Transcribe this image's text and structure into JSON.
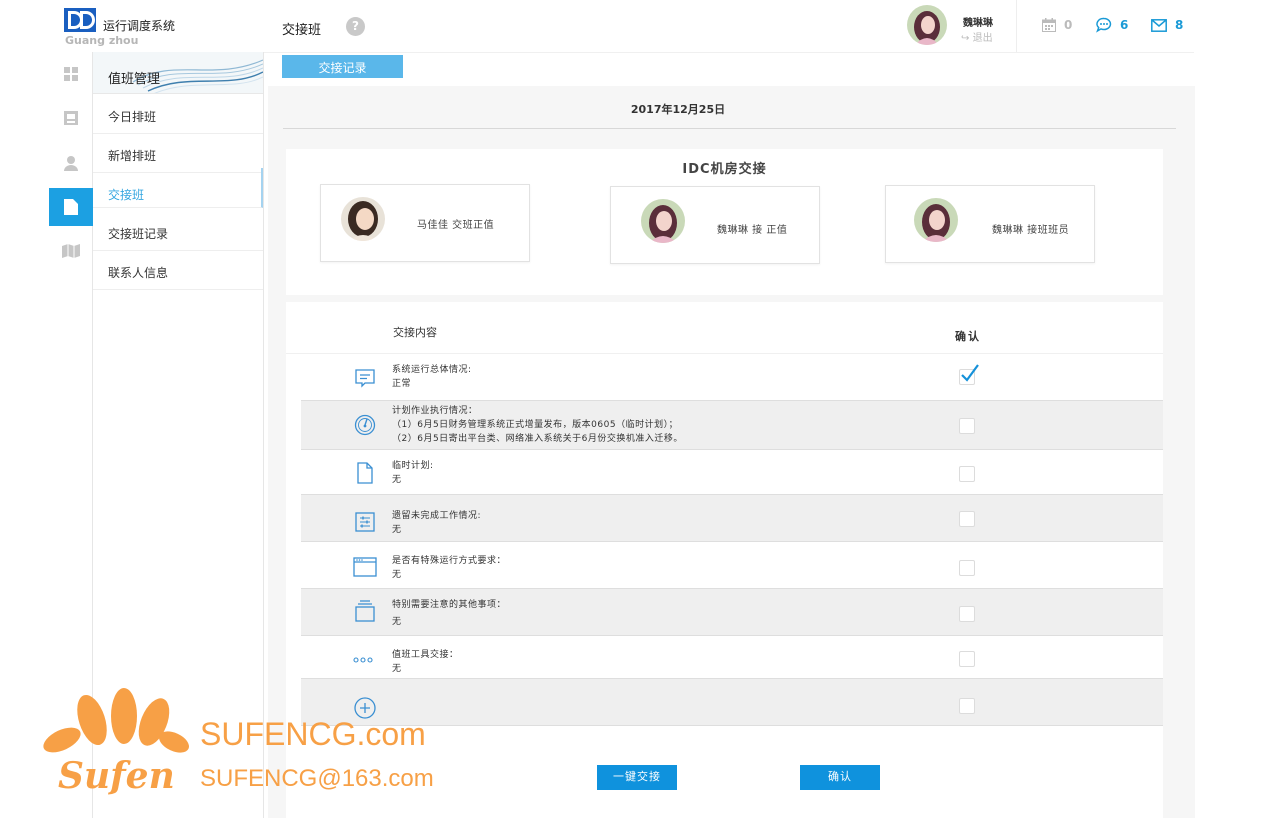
{
  "app": {
    "logo_title": "运行调度系统",
    "logo_sub": "Guang zhou",
    "logo_letter": "D"
  },
  "sidebar": {
    "header": "值班管理",
    "items": [
      {
        "label": "今日排班",
        "active": false
      },
      {
        "label": "新增排班",
        "active": false
      },
      {
        "label": "交接班",
        "active": true
      },
      {
        "label": "交接班记录",
        "active": false
      },
      {
        "label": "联系人信息",
        "active": false
      }
    ]
  },
  "rail": {
    "icons": [
      "grid-icon",
      "id-card-icon",
      "user-icon",
      "document-icon",
      "map-icon"
    ],
    "active_index": 3
  },
  "header": {
    "title": "交接班",
    "help": "?",
    "user_name": "魏琳琳",
    "logout": "退出",
    "stats": [
      {
        "icon": "calendar-icon",
        "count": "0",
        "color": "#bbbbbb"
      },
      {
        "icon": "chat-icon",
        "count": "6",
        "color": "#1a9ad6"
      },
      {
        "icon": "mail-icon",
        "count": "8",
        "color": "#1a9ad6"
      }
    ]
  },
  "tab": {
    "label": "交接记录"
  },
  "main": {
    "date": "2017年12月25日",
    "card_title": "IDC机房交接",
    "people": [
      {
        "label": "马佳佳   交班正值"
      },
      {
        "label": "魏琳琳  接 正值"
      },
      {
        "label": "魏琳琳  接班班员"
      }
    ],
    "columns": {
      "content": "交接内容",
      "confirm": "确认"
    },
    "rows": [
      {
        "icon": "message-icon",
        "lines": [
          "系统运行总体情况:",
          "正常"
        ],
        "checked": true
      },
      {
        "icon": "gauge-icon",
        "lines": [
          "计划作业执行情况：",
          "（1）6月5日财务管理系统正式增量发布，版本0605（临时计划）；",
          "（2）6月5日寄出平台类、网络准入系统关于6月份交换机准入迁移。"
        ],
        "checked": false
      },
      {
        "icon": "file-icon",
        "lines": [
          "临时计划:",
          "无"
        ],
        "checked": false
      },
      {
        "icon": "sliders-icon",
        "lines": [
          "遗留未完成工作情况:",
          "无"
        ],
        "checked": false
      },
      {
        "icon": "window-icon",
        "lines": [
          "是否有特殊运行方式要求：",
          "无"
        ],
        "checked": false
      },
      {
        "icon": "stack-icon",
        "lines": [
          "特别需要注意的其他事项：",
          "无"
        ],
        "checked": false
      },
      {
        "icon": "dots-icon",
        "lines": [
          "值班工具交接：",
          "无"
        ],
        "checked": false
      },
      {
        "icon": "plus-circle-icon",
        "lines": [],
        "checked": false
      }
    ],
    "buttons": {
      "handover": "一键交接",
      "confirm": "确认"
    }
  },
  "watermark": {
    "brand": "Sufen",
    "site": "SUFENCG.com",
    "email": "SUFENCG@163.com",
    "color": "#f7a046"
  }
}
